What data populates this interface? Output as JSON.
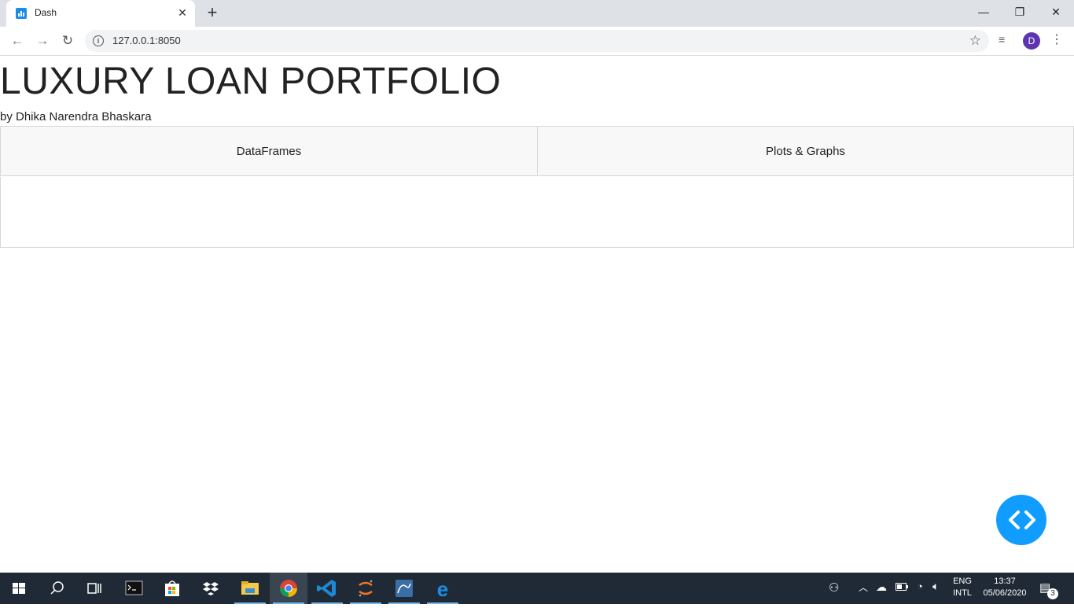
{
  "browser": {
    "tab_title": "Dash",
    "url": "127.0.0.1:8050",
    "profile_initial": "D"
  },
  "page": {
    "title": "LUXURY LOAN PORTFOLIO",
    "byline": "by Dhika Narendra Bhaskara",
    "tabs": [
      {
        "label": "DataFrames"
      },
      {
        "label": "Plots & Graphs"
      }
    ]
  },
  "taskbar": {
    "language": "ENG",
    "layout": "INTL",
    "time": "13:37",
    "date": "05/06/2020",
    "notification_count": "3"
  },
  "colors": {
    "fab": "#119dff",
    "taskbar": "#1f2a36",
    "tab_bg": "#f8f8f8"
  }
}
